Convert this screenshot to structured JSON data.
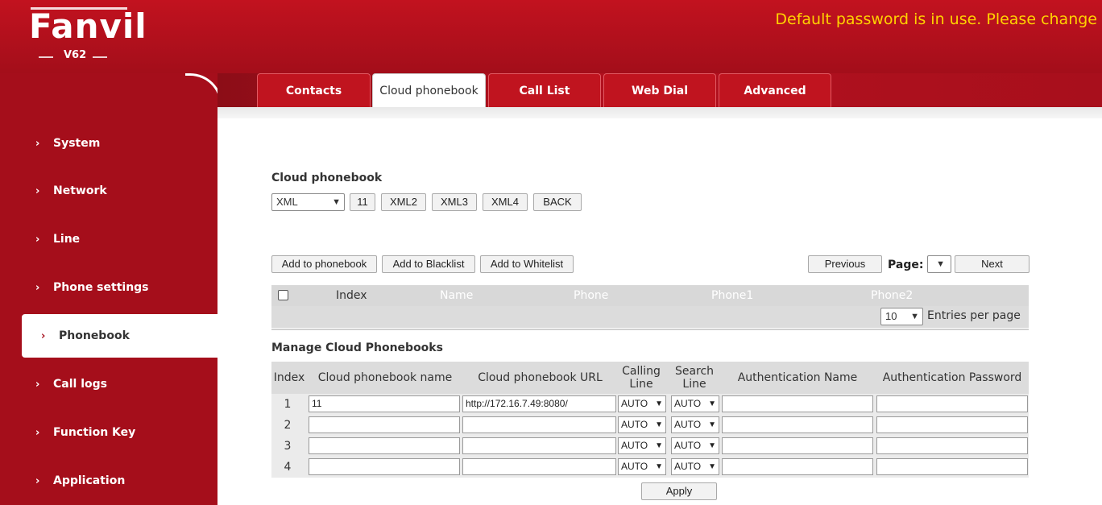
{
  "header": {
    "brand": "Fanvil",
    "model": "V62",
    "warning": "Default password is in use. Please change"
  },
  "tabs": [
    {
      "label": "Contacts"
    },
    {
      "label": "Cloud phonebook"
    },
    {
      "label": "Call List"
    },
    {
      "label": "Web Dial"
    },
    {
      "label": "Advanced"
    }
  ],
  "sidebar": {
    "items": [
      {
        "label": "System"
      },
      {
        "label": "Network"
      },
      {
        "label": "Line"
      },
      {
        "label": "Phone settings"
      },
      {
        "label": "Phonebook"
      },
      {
        "label": "Call logs"
      },
      {
        "label": "Function Key"
      },
      {
        "label": "Application"
      }
    ],
    "chevron": "›"
  },
  "cloud": {
    "title": "Cloud phonebook",
    "select_value": "XML",
    "buttons": [
      "11",
      "XML2",
      "XML3",
      "XML4",
      "BACK"
    ]
  },
  "actions": {
    "add_phonebook": "Add to phonebook",
    "add_blacklist": "Add to Blacklist",
    "add_whitelist": "Add to Whitelist",
    "previous": "Previous",
    "page_label": "Page:",
    "next": "Next"
  },
  "list": {
    "columns": [
      "Index",
      "Name",
      "Phone",
      "Phone1",
      "Phone2"
    ],
    "entries_value": "10",
    "entries_label": "Entries per page"
  },
  "manage": {
    "title": "Manage Cloud Phonebooks",
    "columns": [
      "Index",
      "Cloud phonebook name",
      "Cloud phonebook URL",
      "Calling Line",
      "Search Line",
      "Authentication Name",
      "Authentication Password"
    ],
    "rows": [
      {
        "index": "1",
        "name": "11",
        "url": "http://172.16.7.49:8080/",
        "calling": "AUTO",
        "search": "AUTO",
        "auth_name": "",
        "auth_pass": ""
      },
      {
        "index": "2",
        "name": "",
        "url": "",
        "calling": "AUTO",
        "search": "AUTO",
        "auth_name": "",
        "auth_pass": ""
      },
      {
        "index": "3",
        "name": "",
        "url": "",
        "calling": "AUTO",
        "search": "AUTO",
        "auth_name": "",
        "auth_pass": ""
      },
      {
        "index": "4",
        "name": "",
        "url": "",
        "calling": "AUTO",
        "search": "AUTO",
        "auth_name": "",
        "auth_pass": ""
      }
    ],
    "apply": "Apply"
  },
  "colors": {
    "brand_red": "#a50e1b",
    "warning_yellow": "#ffd200"
  }
}
